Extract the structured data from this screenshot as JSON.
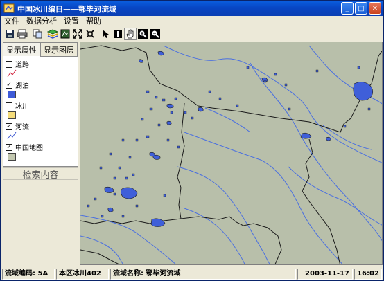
{
  "window": {
    "title": "中国冰川编目——鄂毕河流域"
  },
  "menu": [
    "文件",
    "数据分析",
    "设置",
    "帮助"
  ],
  "toolbar": [
    {
      "icon": "save-icon"
    },
    {
      "icon": "print-icon"
    },
    {
      "icon": "copy-icon"
    },
    {
      "icon": "layers-icon"
    },
    {
      "icon": "full-extent-icon"
    },
    {
      "icon": "zoom-extent-icon"
    },
    {
      "icon": "shrink-extent-icon"
    },
    {
      "icon": "pointer-icon"
    },
    {
      "icon": "info-icon"
    },
    {
      "icon": "pan-hand-icon",
      "pressed": true
    },
    {
      "icon": "zoom-in-icon"
    },
    {
      "icon": "zoom-out-icon"
    }
  ],
  "panel": {
    "tab_properties": "显示属性",
    "tab_layers": "显示图层",
    "search_label": "检索内容"
  },
  "layers": [
    {
      "name": "道路",
      "checked": false,
      "symbol": "line",
      "color": "#d0203a"
    },
    {
      "name": "湖泊",
      "checked": true,
      "symbol": "fill",
      "color": "#3e5bd8"
    },
    {
      "name": "冰川",
      "checked": false,
      "symbol": "fill",
      "color": "#f5dc7a"
    },
    {
      "name": "河流",
      "checked": true,
      "symbol": "line",
      "color": "#3a55d0"
    },
    {
      "name": "中国地图",
      "checked": true,
      "symbol": "fill",
      "color": "#c3c8b0"
    }
  ],
  "status": {
    "basin_code": "流域编码: 5A",
    "region": "本区冰川402",
    "basin_name": "流域名称: 鄂毕河流域",
    "date": "2003-11-17",
    "time": "16:02"
  },
  "colors": {
    "lake": "#3f5fd9",
    "river": "#4a6fe0",
    "land": "#b8bfaa",
    "border": "#1a1a1a"
  }
}
